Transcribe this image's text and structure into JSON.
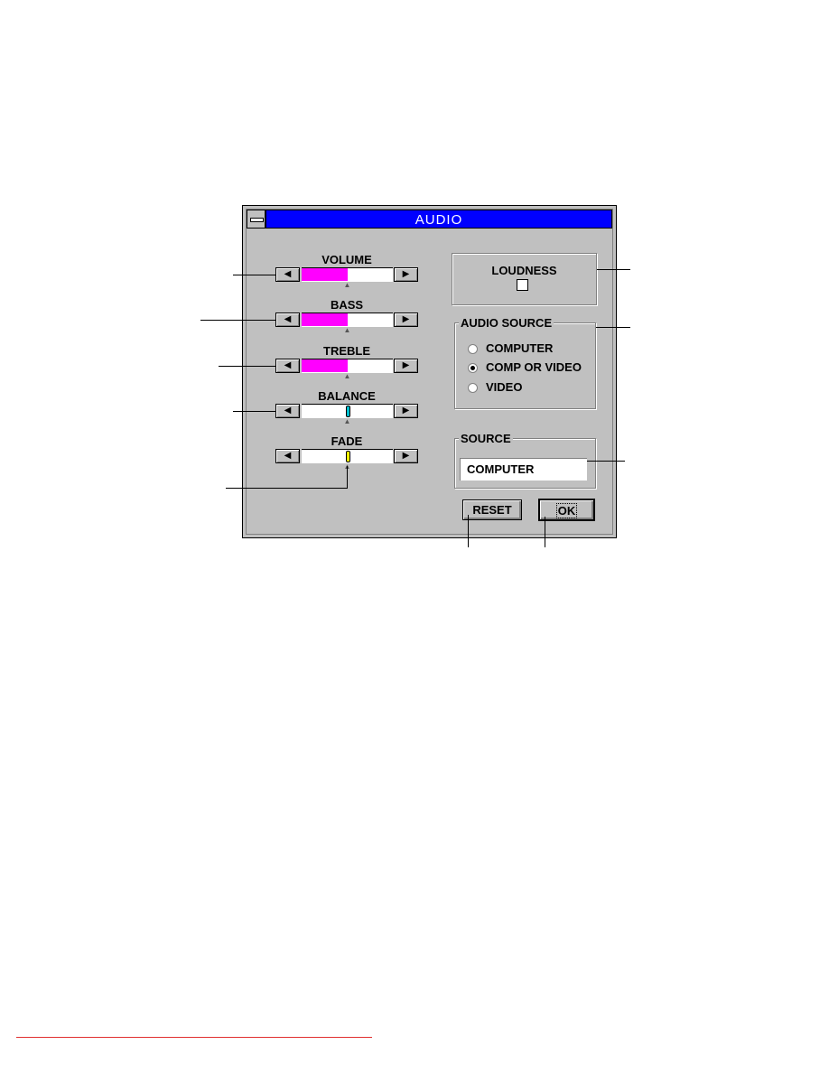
{
  "window": {
    "title": "AUDIO",
    "system_menu_icon": "minus-bar-icon"
  },
  "sliders": [
    {
      "label": "VOLUME",
      "value_percent": 50,
      "style": "fill",
      "color": "#ff00ff"
    },
    {
      "label": "BASS",
      "value_percent": 50,
      "style": "fill",
      "color": "#ff00ff"
    },
    {
      "label": "TREBLE",
      "value_percent": 50,
      "style": "fill",
      "color": "#ff00ff"
    },
    {
      "label": "BALANCE",
      "value_percent": 50,
      "style": "thumb",
      "color": "#00c0d0"
    },
    {
      "label": "FADE",
      "value_percent": 50,
      "style": "thumb",
      "color": "#ffff00"
    }
  ],
  "icons": {
    "left": "◀",
    "right": "▶",
    "marker": "▲"
  },
  "loudness": {
    "label": "LOUDNESS",
    "checked": false
  },
  "audio_source": {
    "label": "AUDIO SOURCE",
    "options": [
      {
        "label": "COMPUTER",
        "selected": false
      },
      {
        "label": "COMP OR VIDEO",
        "selected": true
      },
      {
        "label": "VIDEO",
        "selected": false
      }
    ]
  },
  "source": {
    "label": "SOURCE",
    "value": "COMPUTER"
  },
  "buttons": {
    "reset": "RESET",
    "ok": "OK"
  }
}
